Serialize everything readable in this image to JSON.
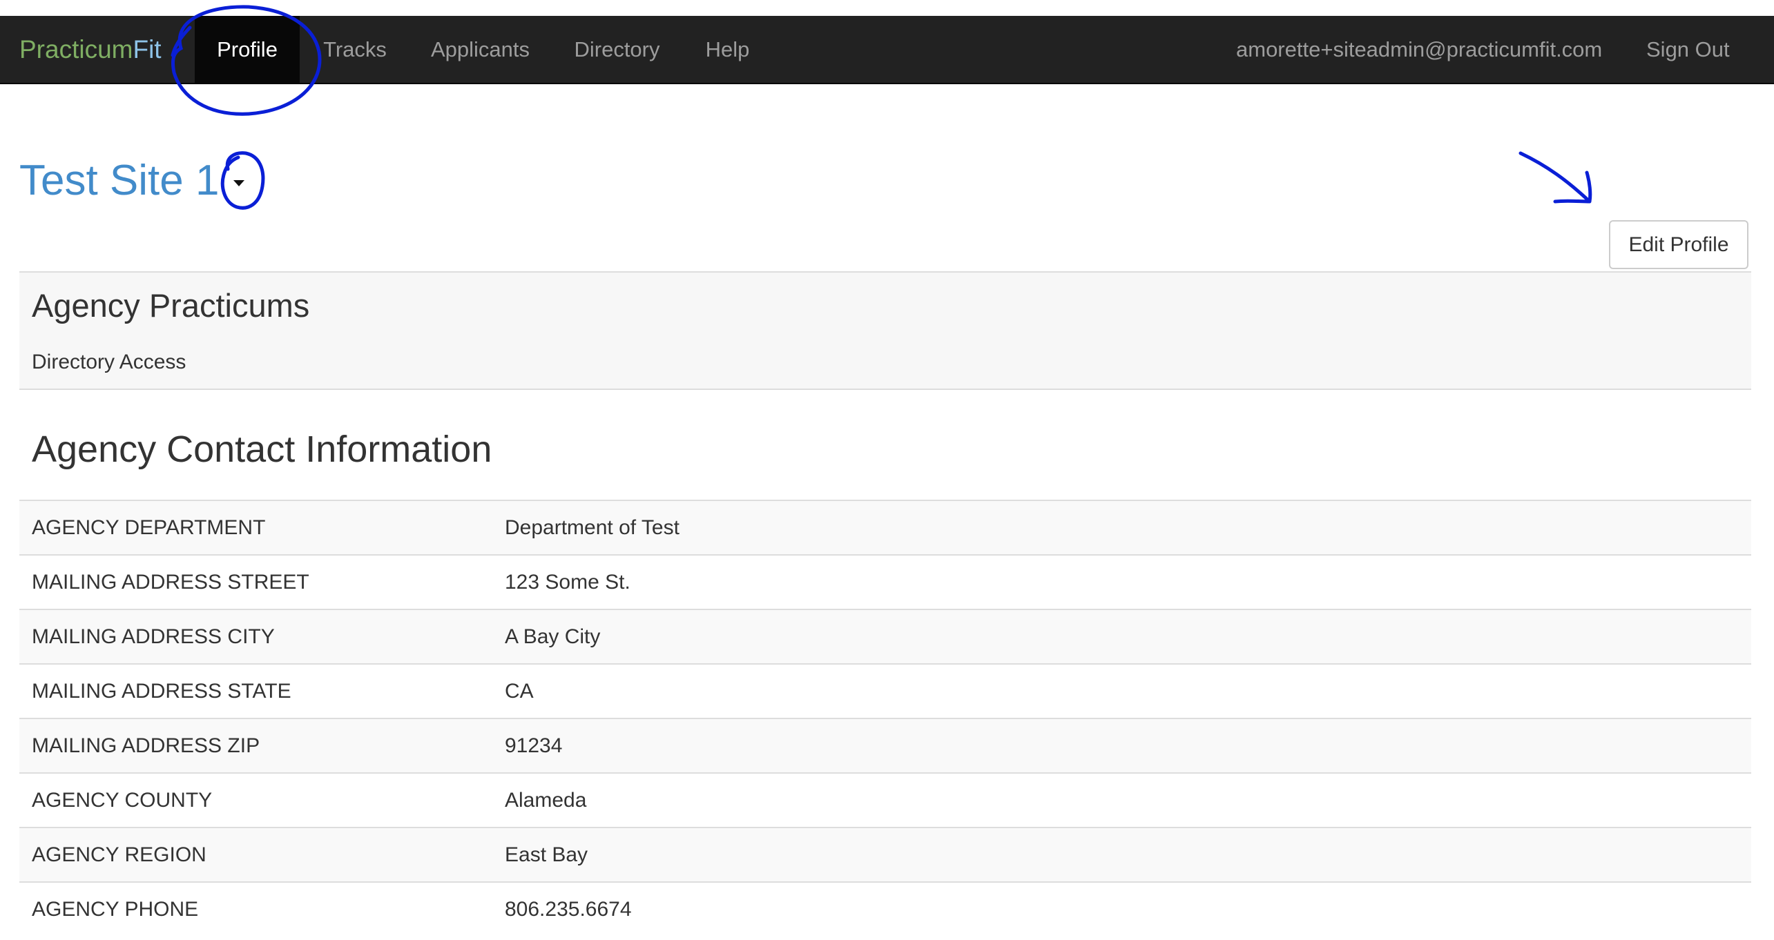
{
  "navbar": {
    "brand_part1": "Practicum",
    "brand_part2": "Fit",
    "items": [
      {
        "label": "Profile",
        "active": true
      },
      {
        "label": "Tracks",
        "active": false
      },
      {
        "label": "Applicants",
        "active": false
      },
      {
        "label": "Directory",
        "active": false
      },
      {
        "label": "Help",
        "active": false
      }
    ],
    "user_email": "amorette+siteadmin@practicumfit.com",
    "sign_out": "Sign Out"
  },
  "page": {
    "title": "Test Site 1",
    "edit_button": "Edit Profile"
  },
  "practicums_panel": {
    "title": "Agency Practicums",
    "subtitle": "Directory Access"
  },
  "contact": {
    "title": "Agency Contact Information",
    "rows": [
      {
        "label": "AGENCY DEPARTMENT",
        "value": "Department of Test"
      },
      {
        "label": "MAILING ADDRESS STREET",
        "value": "123 Some St."
      },
      {
        "label": "MAILING ADDRESS CITY",
        "value": "A Bay City"
      },
      {
        "label": "MAILING ADDRESS STATE",
        "value": "CA"
      },
      {
        "label": "MAILING ADDRESS ZIP",
        "value": "91234"
      },
      {
        "label": "AGENCY COUNTY",
        "value": "Alameda"
      },
      {
        "label": "AGENCY REGION",
        "value": "East Bay"
      },
      {
        "label": "AGENCY PHONE",
        "value": "806.235.6674"
      }
    ]
  },
  "colors": {
    "navbar_bg": "#222222",
    "brand_green": "#7fae63",
    "brand_blue": "#8ec3e8",
    "title_blue": "#428bca",
    "annotation_ink": "#0a1fd6"
  },
  "icons": [
    "dropdown-caret-icon"
  ]
}
